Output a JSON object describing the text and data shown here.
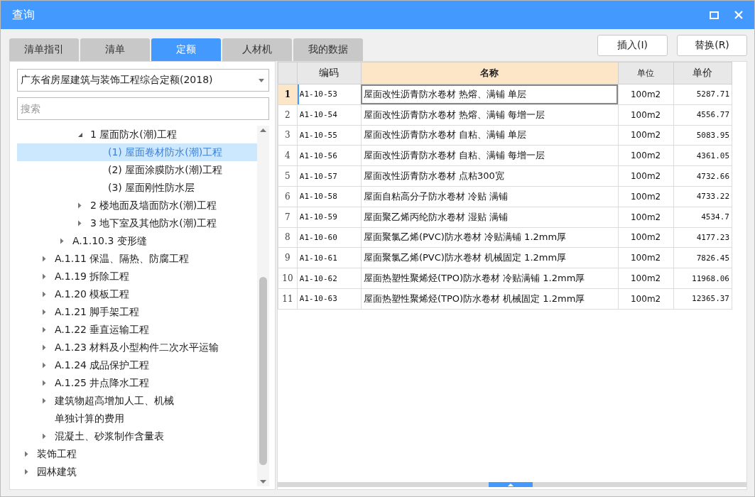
{
  "window": {
    "title": "查询"
  },
  "tabs": [
    {
      "label": "清单指引",
      "selected": false
    },
    {
      "label": "清单",
      "selected": false
    },
    {
      "label": "定额",
      "selected": true
    },
    {
      "label": "人材机",
      "selected": false
    },
    {
      "label": "我的数据",
      "selected": false
    }
  ],
  "buttons": [
    "插入(I)",
    "替换(R)"
  ],
  "library": {
    "value": "广东省房屋建筑与装饰工程综合定额(2018)"
  },
  "search": {
    "placeholder": "搜索"
  },
  "tree": [
    {
      "children": [
        {
          "children": [
            {
              "children": [
                {
                  "label": "1 屋面防水(潮)工程",
                  "kind": "folder",
                  "expanded": true,
                  "selected": false,
                  "children": [
                    {
                      "label": "(1) 屋面卷材防水(潮)工程",
                      "kind": "leaf",
                      "selected": true
                    },
                    {
                      "label": "(2) 屋面涂膜防水(潮)工程",
                      "kind": "leaf",
                      "selected": false
                    },
                    {
                      "label": "(3) 屋面刚性防水层",
                      "kind": "leaf",
                      "selected": false
                    }
                  ]
                },
                {
                  "label": "2 楼地面及墙面防水(潮)工程",
                  "kind": "folder",
                  "expanded": false,
                  "selected": false
                },
                {
                  "label": "3 地下室及其他防水(潮)工程",
                  "kind": "folder",
                  "expanded": false,
                  "selected": false
                }
              ]
            },
            {
              "label": "A.1.10.3 变形缝",
              "kind": "folder",
              "expanded": false,
              "selected": false
            }
          ]
        },
        {
          "label": "A.1.11 保温、隔热、防腐工程",
          "kind": "folder",
          "expanded": false,
          "selected": false
        },
        {
          "label": "A.1.19 拆除工程",
          "kind": "folder",
          "expanded": false,
          "selected": false
        },
        {
          "label": "A.1.20 模板工程",
          "kind": "folder",
          "expanded": false,
          "selected": false
        },
        {
          "label": "A.1.21 脚手架工程",
          "kind": "folder",
          "expanded": false,
          "selected": false
        },
        {
          "label": "A.1.22 垂直运输工程",
          "kind": "folder",
          "expanded": false,
          "selected": false
        },
        {
          "label": "A.1.23 材料及小型构件二次水平运输",
          "kind": "folder",
          "expanded": false,
          "selected": false
        },
        {
          "label": "A.1.24 成品保护工程",
          "kind": "folder",
          "expanded": false,
          "selected": false
        },
        {
          "label": "A.1.25 井点降水工程",
          "kind": "folder",
          "expanded": false,
          "selected": false
        },
        {
          "lines": [
            "建筑物超高增加人工、机械",
            "单独计算的费用"
          ],
          "kind": "folder",
          "expanded": false,
          "selected": false
        },
        {
          "label": "混凝土、砂浆制作含量表",
          "kind": "folder",
          "expanded": false,
          "selected": false
        }
      ]
    },
    {
      "label": "装饰工程",
      "kind": "folder",
      "expanded": false,
      "selected": false
    },
    {
      "label": "园林建筑",
      "kind": "folder",
      "expanded": false,
      "selected": false
    }
  ],
  "table": {
    "columns": [
      {
        "label": "编码",
        "selected": false
      },
      {
        "label": "名称",
        "selected": true
      },
      {
        "label": "单位",
        "selected": false
      },
      {
        "label": "单价",
        "selected": false
      }
    ],
    "rows": [
      {
        "no": "1",
        "code": "A1-10-53",
        "name": "屋面改性沥青防水卷材 热熔、满铺 单层",
        "unit": "100m2",
        "price": "5287.71",
        "selected": true
      },
      {
        "no": "2",
        "code": "A1-10-54",
        "name": "屋面改性沥青防水卷材 热熔、满铺 每增一层",
        "unit": "100m2",
        "price": "4556.77",
        "selected": false
      },
      {
        "no": "3",
        "code": "A1-10-55",
        "name": "屋面改性沥青防水卷材 自粘、满铺 单层",
        "unit": "100m2",
        "price": "5083.95",
        "selected": false
      },
      {
        "no": "4",
        "code": "A1-10-56",
        "name": "屋面改性沥青防水卷材 自粘、满铺 每增一层",
        "unit": "100m2",
        "price": "4361.05",
        "selected": false
      },
      {
        "no": "5",
        "code": "A1-10-57",
        "name": "屋面改性沥青防水卷材 点粘300宽",
        "unit": "100m2",
        "price": "4732.66",
        "selected": false
      },
      {
        "no": "6",
        "code": "A1-10-58",
        "name": "屋面自粘高分子防水卷材 冷贴 满铺",
        "unit": "100m2",
        "price": "4733.22",
        "selected": false
      },
      {
        "no": "7",
        "code": "A1-10-59",
        "name": "屋面聚乙烯丙纶防水卷材 湿贴 满铺",
        "unit": "100m2",
        "price": "4534.7",
        "selected": false
      },
      {
        "no": "8",
        "code": "A1-10-60",
        "name": "屋面聚氯乙烯(PVC)防水卷材 冷贴满铺 1.2mm厚",
        "unit": "100m2",
        "price": "4177.23",
        "selected": false
      },
      {
        "no": "9",
        "code": "A1-10-61",
        "name": "屋面聚氯乙烯(PVC)防水卷材 机械固定 1.2mm厚",
        "unit": "100m2",
        "price": "7826.45",
        "selected": false
      },
      {
        "no": "10",
        "code": "A1-10-62",
        "name": "屋面热塑性聚烯烃(TPO)防水卷材 冷贴满铺 1.2mm厚",
        "unit": "100m2",
        "price": "11968.06",
        "selected": false
      },
      {
        "no": "11",
        "code": "A1-10-63",
        "name": "屋面热塑性聚烯烃(TPO)防水卷材 机械固定 1.2mm厚",
        "unit": "100m2",
        "price": "12365.37",
        "selected": false
      }
    ]
  }
}
